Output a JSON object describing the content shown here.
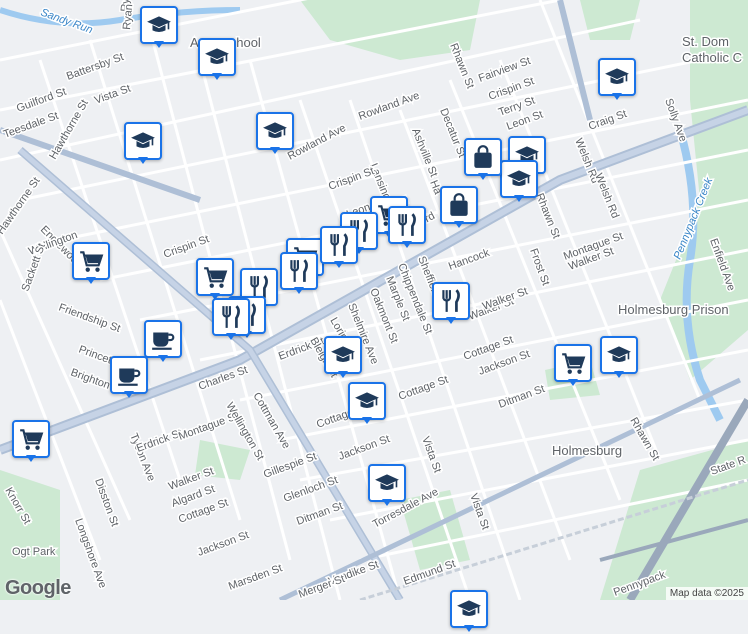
{
  "map": {
    "attribution": "Map data ©2025",
    "logo": "Google"
  },
  "streets": [
    {
      "name": "Sandy Run",
      "kind": "water"
    },
    {
      "name": "Ryan"
    },
    {
      "name": "Battersby St"
    },
    {
      "name": "Vista St"
    },
    {
      "name": "Guilford St"
    },
    {
      "name": "Teesdale St"
    },
    {
      "name": "Hawthorne St"
    },
    {
      "name": "Rowland Ave"
    },
    {
      "name": "Rowland Ave"
    },
    {
      "name": "Ashville St"
    },
    {
      "name": "Decatur St"
    },
    {
      "name": "Lansing St"
    },
    {
      "name": "Crispin St"
    },
    {
      "name": "Crispin St"
    },
    {
      "name": "Rhawn St"
    },
    {
      "name": "Fairview St"
    },
    {
      "name": "Crispin St"
    },
    {
      "name": "Terry St"
    },
    {
      "name": "Leon St"
    },
    {
      "name": "Craig St"
    },
    {
      "name": "Solly Ave"
    },
    {
      "name": "Welsh Rd"
    },
    {
      "name": "Welsh Rd"
    },
    {
      "name": "Rhawn St"
    },
    {
      "name": "Frost St"
    },
    {
      "name": "Montague St"
    },
    {
      "name": "Walker St"
    },
    {
      "name": "Enfield Ave"
    },
    {
      "name": "Pennypack Creek",
      "kind": "water"
    },
    {
      "name": "Hawthorne St"
    },
    {
      "name": "Englewood"
    },
    {
      "name": "Wellington"
    },
    {
      "name": "Sackett St"
    },
    {
      "name": "Friendship St"
    },
    {
      "name": "Princeton"
    },
    {
      "name": "Brighton St"
    },
    {
      "name": "Tyson Ave"
    },
    {
      "name": "Disston St"
    },
    {
      "name": "Longshore Ave"
    },
    {
      "name": "Knorr St"
    },
    {
      "name": "Charles St"
    },
    {
      "name": "Erdrick St"
    },
    {
      "name": "Montague St"
    },
    {
      "name": "Wellington St"
    },
    {
      "name": "Walker St"
    },
    {
      "name": "Algard St"
    },
    {
      "name": "Cottage St"
    },
    {
      "name": "Jackson St"
    },
    {
      "name": "Gillespie St"
    },
    {
      "name": "Glenloch St"
    },
    {
      "name": "Ditman St"
    },
    {
      "name": "Cottman Ave"
    },
    {
      "name": "Erdrick St"
    },
    {
      "name": "Bleigh St"
    },
    {
      "name": "Loring St"
    },
    {
      "name": "Shelmire Ave"
    },
    {
      "name": "Oakmont St"
    },
    {
      "name": "Marple St"
    },
    {
      "name": "Chippendale St"
    },
    {
      "name": "Sheffield"
    },
    {
      "name": "Frankford"
    },
    {
      "name": "Walker St"
    },
    {
      "name": "Cottage St"
    },
    {
      "name": "Jackson St"
    },
    {
      "name": "Vista St"
    },
    {
      "name": "Torresdale Ave"
    },
    {
      "name": "Vista St"
    },
    {
      "name": "Edmund St"
    },
    {
      "name": "Vandike St"
    },
    {
      "name": "Marsden St"
    },
    {
      "name": "Cottage St"
    },
    {
      "name": "Ditman St"
    },
    {
      "name": "Jackson St"
    },
    {
      "name": "Cottage St"
    },
    {
      "name": "Rhawn St"
    },
    {
      "name": "State R"
    },
    {
      "name": "Hancock"
    },
    {
      "name": "Walker St"
    },
    {
      "name": "Leon"
    },
    {
      "name": "Me"
    },
    {
      "name": "Ha"
    },
    {
      "name": "Pennypack"
    },
    {
      "name": "Ogt Park"
    },
    {
      "name": "Merger St"
    },
    {
      "name": "Ryan"
    }
  ],
  "places": {
    "school_label": "Ac     school",
    "stdom": "St. Dom",
    "catholic": "Catholic C",
    "prison": "Holmesburg Prison",
    "holmesburg": "Holmesburg"
  },
  "pins": [
    {
      "type": "school"
    },
    {
      "type": "school"
    },
    {
      "type": "school"
    },
    {
      "type": "school"
    },
    {
      "type": "school"
    },
    {
      "type": "school"
    },
    {
      "type": "school"
    },
    {
      "type": "shopping"
    },
    {
      "type": "shopping"
    },
    {
      "type": "grocery"
    },
    {
      "type": "grocery"
    },
    {
      "type": "grocery"
    },
    {
      "type": "grocery"
    },
    {
      "type": "restaurant"
    },
    {
      "type": "restaurant"
    },
    {
      "type": "restaurant"
    },
    {
      "type": "restaurant"
    },
    {
      "type": "restaurant"
    },
    {
      "type": "restaurant"
    },
    {
      "type": "restaurant"
    },
    {
      "type": "restaurant"
    },
    {
      "type": "cafe"
    },
    {
      "type": "cafe"
    },
    {
      "type": "school"
    },
    {
      "type": "school"
    },
    {
      "type": "school"
    },
    {
      "type": "school"
    },
    {
      "type": "grocery"
    },
    {
      "type": "grocery"
    },
    {
      "type": "school"
    }
  ]
}
